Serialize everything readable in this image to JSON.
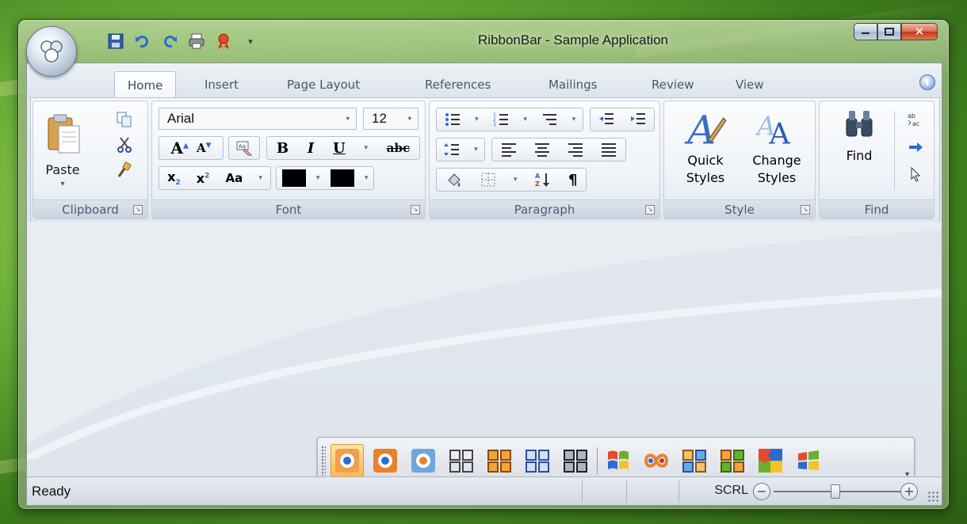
{
  "window": {
    "title": "RibbonBar - Sample Application",
    "accent": "#6fb23a"
  },
  "quick_access": {
    "items": [
      "save-icon",
      "undo-icon",
      "redo-icon",
      "print-icon",
      "award-icon"
    ]
  },
  "tabs": [
    {
      "label": "Home",
      "active": true
    },
    {
      "label": "Insert"
    },
    {
      "label": "Page Layout"
    },
    {
      "label": "References"
    },
    {
      "label": "Mailings"
    },
    {
      "label": "Review"
    },
    {
      "label": "View"
    }
  ],
  "ribbon": {
    "clipboard": {
      "label": "Clipboard",
      "paste_label": "Paste"
    },
    "font": {
      "label": "Font",
      "font_name": "Arial",
      "font_size": "12"
    },
    "paragraph": {
      "label": "Paragraph"
    },
    "style": {
      "label": "Style",
      "quick_styles_label": "Quick Styles",
      "change_styles_label": "Change Styles"
    },
    "find": {
      "label": "Find",
      "find_label": "Find"
    }
  },
  "status": {
    "text": "Ready",
    "scrl": "SCRL"
  }
}
